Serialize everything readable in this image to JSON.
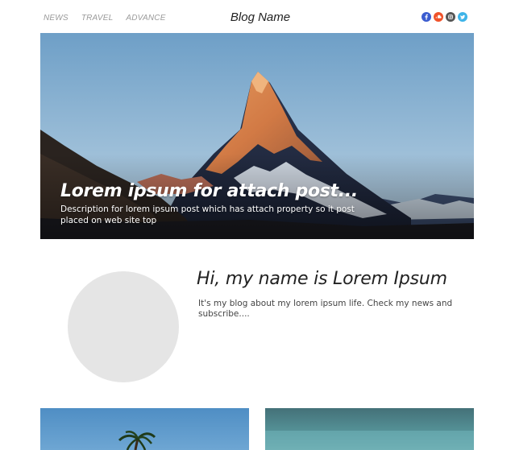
{
  "header": {
    "nav": [
      {
        "label": "NEWS"
      },
      {
        "label": "TRAVEL"
      },
      {
        "label": "ADVANCE"
      }
    ],
    "brand": "Blog Name",
    "social": [
      {
        "icon": "facebook-icon",
        "color": "#3b5ccf"
      },
      {
        "icon": "soundcloud-icon",
        "color": "#f0522a"
      },
      {
        "icon": "instagram-icon",
        "color": "#555555"
      },
      {
        "icon": "twitter-icon",
        "color": "#3fb4e8"
      }
    ]
  },
  "hero": {
    "title": "Lorem ipsum for attach post...",
    "description": "Description for lorem ipsum post which has attach property so it post placed on web site top"
  },
  "about": {
    "title": "Hi, my name is Lorem Ipsum",
    "text": "It's my blog about my lorem ipsum life. Check my news and subscribe...."
  },
  "cards": [
    {
      "image": "palm-tree-photo"
    },
    {
      "image": "sea-photo"
    }
  ]
}
